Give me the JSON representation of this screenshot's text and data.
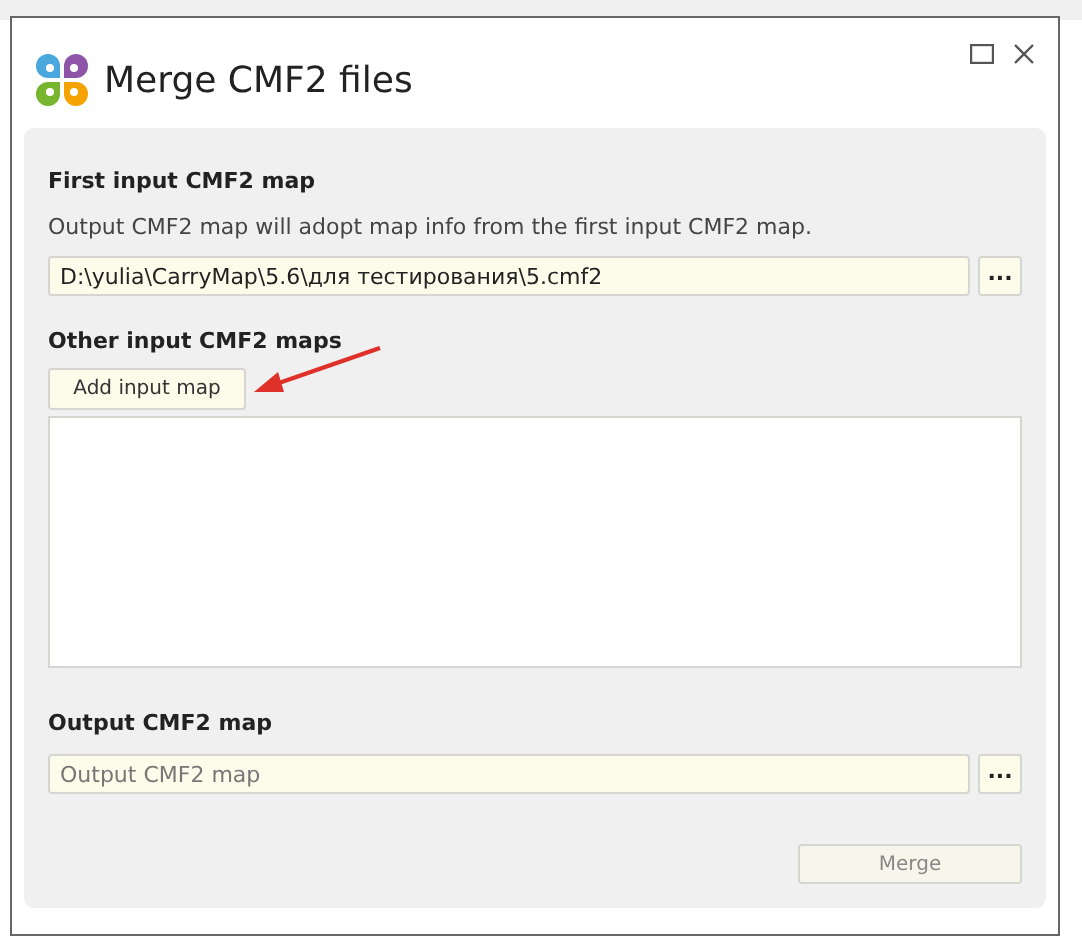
{
  "window": {
    "title": "Merge CMF2 files"
  },
  "first_input": {
    "heading": "First input CMF2 map",
    "description": "Output CMF2 map will adopt map info from the first input CMF2 map.",
    "field": {
      "value": "D:\\yulia\\CarryMap\\5.6\\для тестирования\\5.cmf2"
    },
    "browse_button": "..."
  },
  "other_inputs": {
    "heading": "Other input CMF2 maps",
    "add_button": "Add input map"
  },
  "output": {
    "heading": "Output CMF2 map",
    "field": {
      "placeholder": "Output CMF2 map"
    },
    "browse_button": "..."
  },
  "merge_button": {
    "label": "Merge",
    "disabled": true
  }
}
